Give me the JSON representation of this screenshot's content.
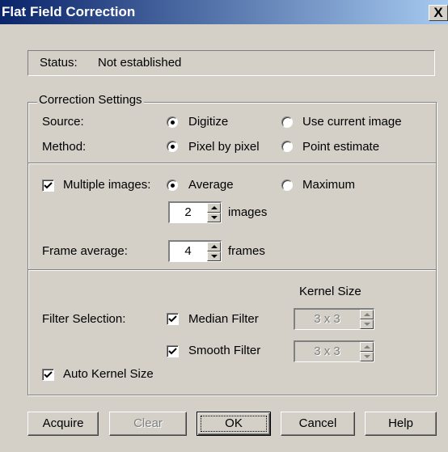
{
  "window": {
    "title": "Flat Field Correction",
    "close_glyph": "X"
  },
  "status": {
    "label": "Status:",
    "value": "Not established"
  },
  "correction_settings": {
    "legend": "Correction Settings",
    "source": {
      "label": "Source:",
      "options": [
        "Digitize",
        "Use current image"
      ],
      "selected": "Digitize"
    },
    "method": {
      "label": "Method:",
      "options": [
        "Pixel by pixel",
        "Point estimate"
      ],
      "selected": "Pixel by pixel"
    }
  },
  "multiple": {
    "checkbox_label": "Multiple images:",
    "checked": true,
    "options": [
      "Average",
      "Maximum"
    ],
    "selected": "Average",
    "images_value": "2",
    "images_unit": "images",
    "frame_label": "Frame average:",
    "frame_value": "4",
    "frame_unit": "frames"
  },
  "filter": {
    "kernel_header": "Kernel Size",
    "selection_label": "Filter Selection:",
    "median_label": "Median Filter",
    "median_checked": true,
    "median_kernel": "3 x 3",
    "smooth_label": "Smooth Filter",
    "smooth_checked": true,
    "smooth_kernel": "3 x 3",
    "auto_label": "Auto Kernel Size",
    "auto_checked": true
  },
  "buttons": {
    "acquire": "Acquire",
    "clear": "Clear",
    "ok": "OK",
    "cancel": "Cancel",
    "help": "Help"
  },
  "colors": {
    "dialog_bg": "#d4d0c8",
    "titlebar_start": "#0a246a",
    "titlebar_end": "#a6caf0",
    "disabled_text": "#808080"
  }
}
